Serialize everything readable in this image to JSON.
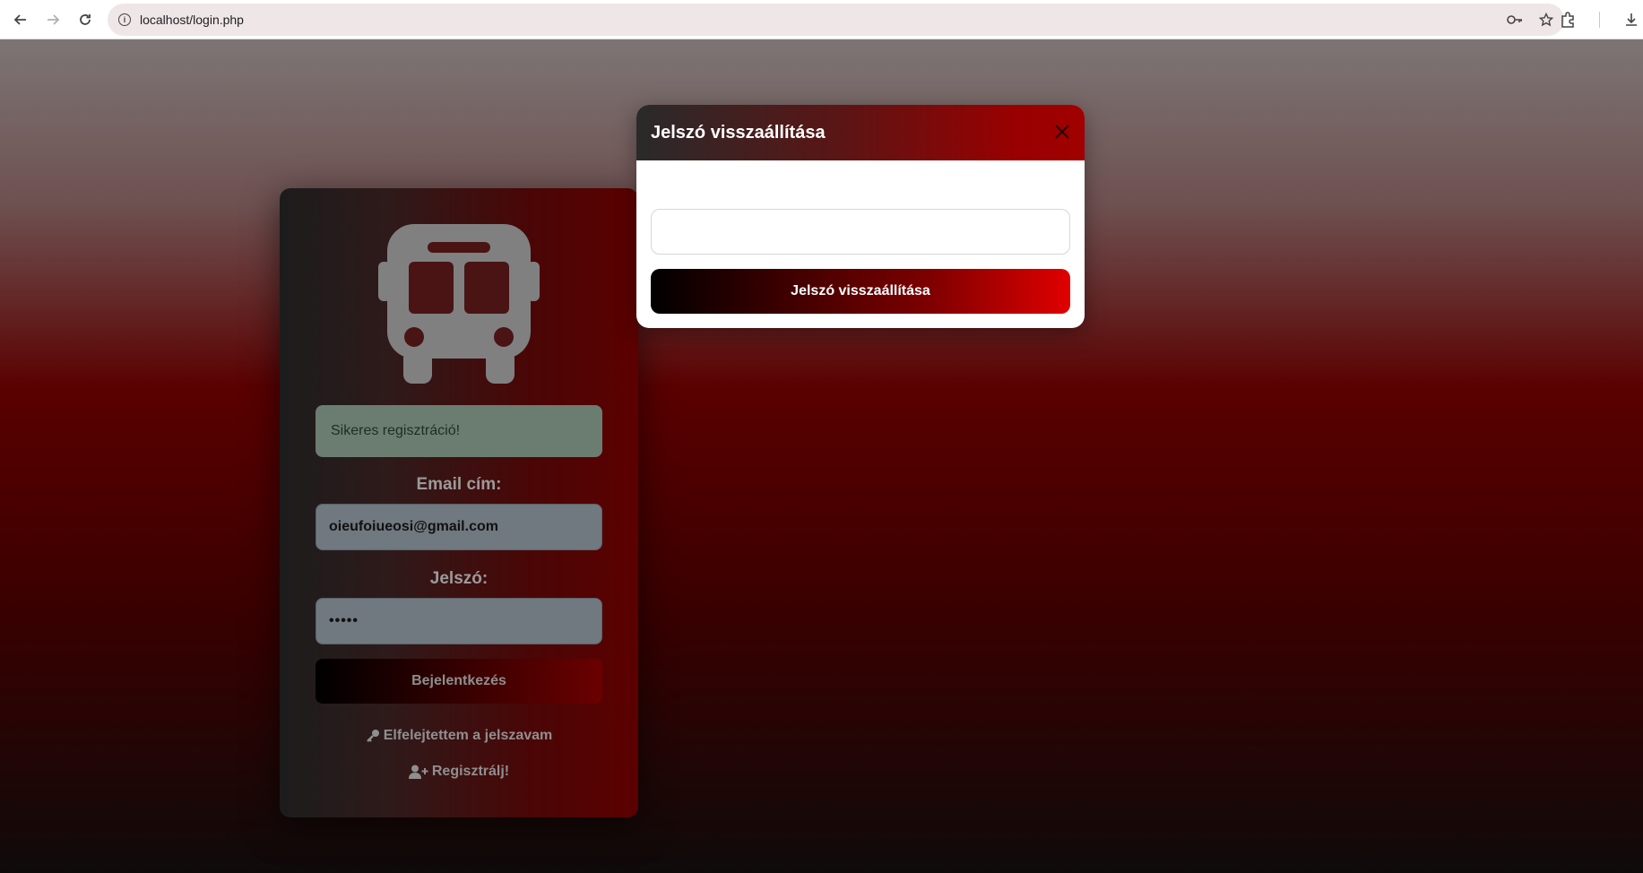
{
  "browser": {
    "url": "localhost/login.php"
  },
  "login": {
    "success_message": "Sikeres regisztráció!",
    "email_label": "Email cím:",
    "email_value": "oieufoiueosi@gmail.com",
    "password_label": "Jelszó:",
    "password_value": "•••••",
    "login_button": "Bejelentkezés",
    "forgot_link": "Elfelejtettem a jelszavam",
    "register_link": "Regisztrálj!"
  },
  "modal": {
    "title": "Jelszó visszaállítása",
    "submit_button": "Jelszó visszaállítása"
  },
  "colors": {
    "accent_red": "#e00000",
    "success_bg": "#6b7d70",
    "icon_gray": "#808080"
  }
}
